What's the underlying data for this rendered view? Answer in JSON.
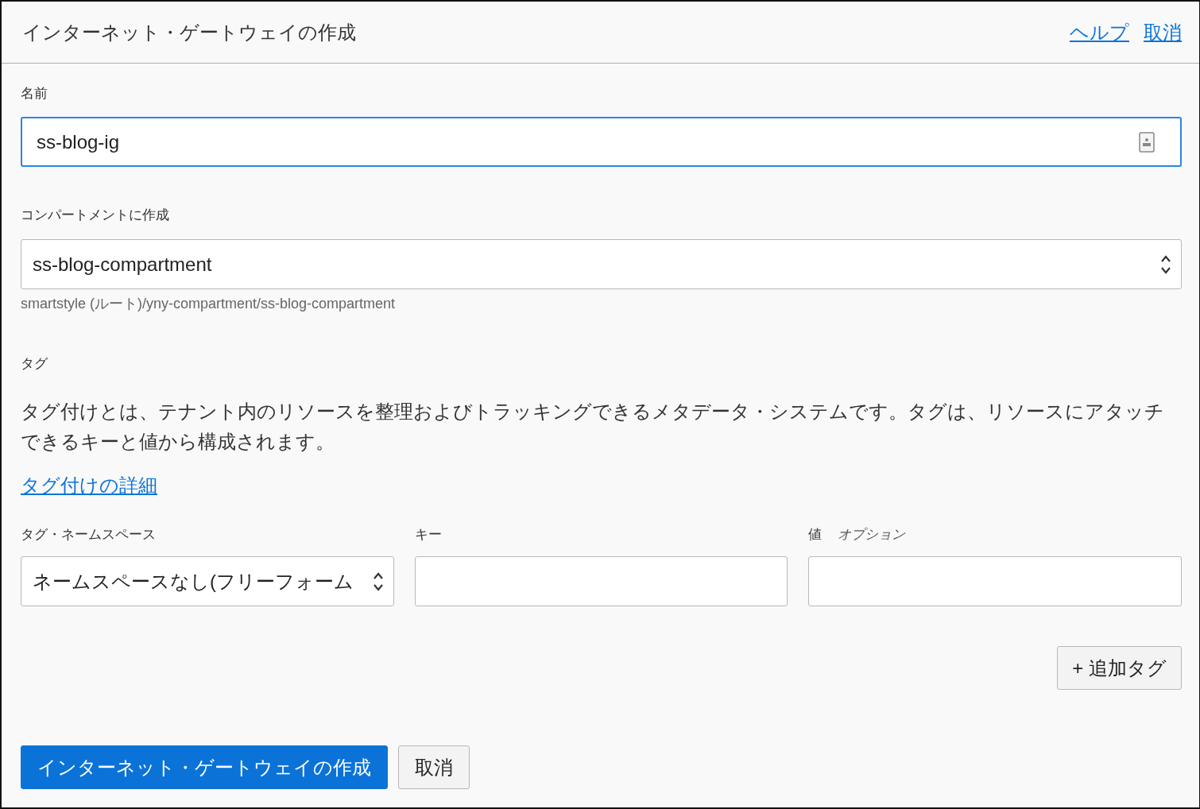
{
  "dialog": {
    "title": "インターネット・ゲートウェイの作成",
    "header_links": [
      "ヘルプ",
      "取消"
    ]
  },
  "name_field": {
    "label": "名前",
    "value": "ss-blog-ig"
  },
  "compartment": {
    "label": "コンパートメントに作成",
    "value": "ss-blog-compartment",
    "path": "smartstyle (ルート)/yny-compartment/ss-blog-compartment"
  },
  "tags": {
    "label": "タグ",
    "description": "タグ付けとは、テナント内のリソースを整理およびトラッキングできるメタデータ・システムです。タグは、リソースにアタッチできるキーと値から構成されます。",
    "link": "タグ付けの詳細",
    "columns": [
      {
        "label": "タグ・ネームスペース",
        "kind": "select",
        "value": "ネームスペースなし(フリーフォーム"
      },
      {
        "label": "キー",
        "kind": "input"
      },
      {
        "label": "値",
        "hint": "オプション",
        "kind": "input"
      }
    ],
    "add_button": "+ 追加タグ"
  },
  "actions": [
    {
      "label": "インターネット・ゲートウェイの作成",
      "kind": "primary"
    },
    {
      "label": "取消",
      "kind": "secondary"
    }
  ]
}
